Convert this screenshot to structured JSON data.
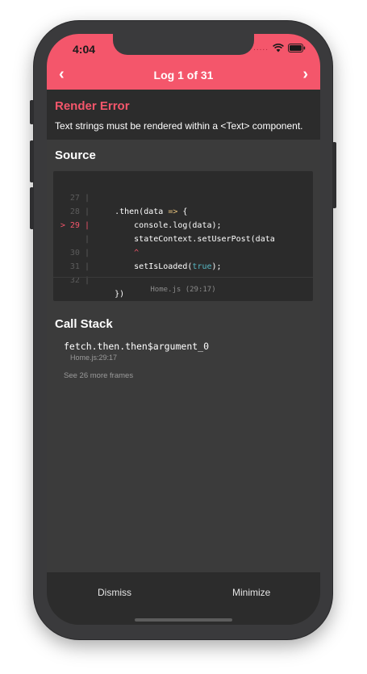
{
  "status_bar": {
    "time": "4:04",
    "icons": [
      "wifi-icon",
      "battery-icon"
    ],
    "signal_dots": "....."
  },
  "nav": {
    "title": "Log 1 of 31",
    "prev_icon": "chevron-left-icon",
    "next_icon": "chevron-right-icon",
    "prev_label": "‹",
    "next_label": "›"
  },
  "error": {
    "title": "Render Error",
    "message": "Text strings must be rendered within a <Text> component."
  },
  "source": {
    "title": "Source",
    "lines": [
      {
        "num": "27 |",
        "code": "    .then(data => {"
      },
      {
        "num": "28 |",
        "code": "        console.log(data);"
      },
      {
        "num": "> 29 |",
        "code": "        stateContext.setUserPost(data"
      },
      {
        "num": "|",
        "code": "        ^"
      },
      {
        "num": "30 |",
        "code": "        setIsLoaded(true);"
      },
      {
        "num": "31 |",
        "code": ""
      },
      {
        "num": "32 |",
        "code": "    })"
      }
    ],
    "file": "Home.js (29:17)"
  },
  "call_stack": {
    "title": "Call Stack",
    "frame_name": "fetch.then.then$argument_0",
    "frame_location": "Home.js:29:17",
    "more": "See 26 more frames"
  },
  "footer": {
    "dismiss": "Dismiss",
    "minimize": "Minimize"
  },
  "colors": {
    "accent": "#f4566b",
    "background": "#3b3b3b",
    "panel": "#2c2c2c"
  }
}
